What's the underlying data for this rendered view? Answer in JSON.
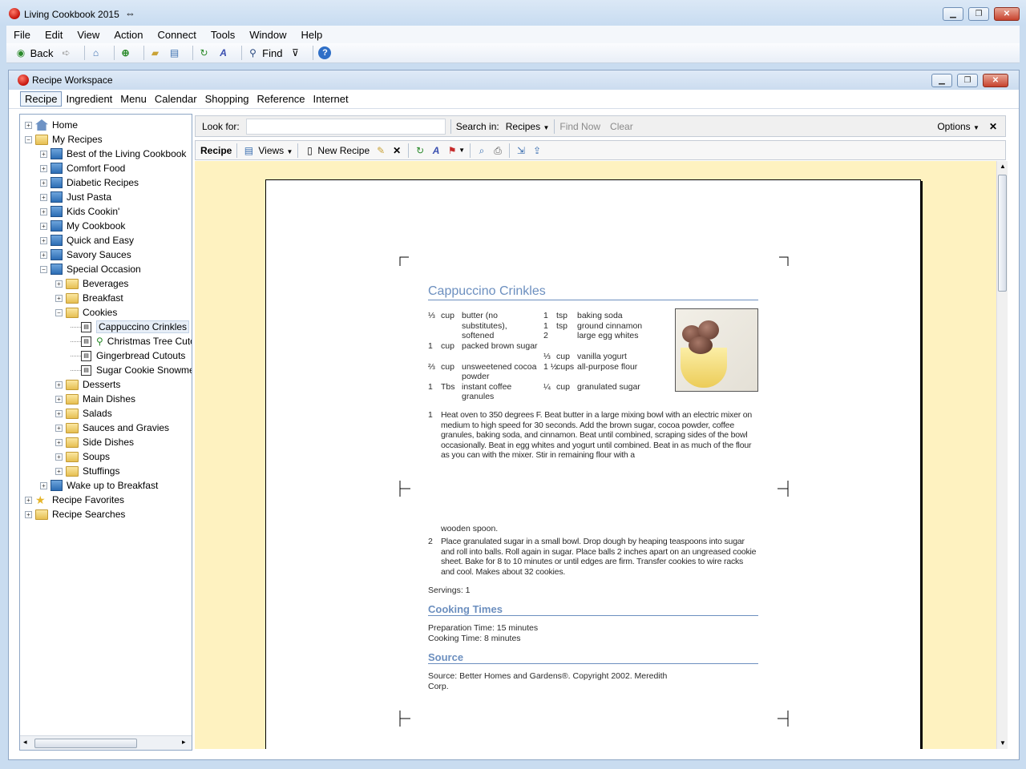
{
  "app": {
    "title": "Living Cookbook 2015"
  },
  "menubar": [
    "File",
    "Edit",
    "View",
    "Action",
    "Connect",
    "Tools",
    "Window",
    "Help"
  ],
  "toolbar": {
    "back": "Back",
    "find": "Find"
  },
  "workspace": {
    "title": "Recipe Workspace",
    "tabs": [
      "Recipe",
      "Ingredient",
      "Menu",
      "Calendar",
      "Shopping",
      "Reference",
      "Internet"
    ]
  },
  "tree": [
    {
      "label": "Home",
      "level": 0,
      "icon": "home"
    },
    {
      "label": "My Recipes",
      "level": 0,
      "icon": "folder"
    },
    {
      "label": "Best of the Living Cookbook",
      "level": 1,
      "icon": "book"
    },
    {
      "label": "Comfort Food",
      "level": 1,
      "icon": "book"
    },
    {
      "label": "Diabetic Recipes",
      "level": 1,
      "icon": "book"
    },
    {
      "label": "Just Pasta",
      "level": 1,
      "icon": "book"
    },
    {
      "label": "Kids Cookin'",
      "level": 1,
      "icon": "book"
    },
    {
      "label": "My Cookbook",
      "level": 1,
      "icon": "book"
    },
    {
      "label": "Quick and Easy",
      "level": 1,
      "icon": "book"
    },
    {
      "label": "Savory Sauces",
      "level": 1,
      "icon": "book"
    },
    {
      "label": "Special Occasion",
      "level": 1,
      "icon": "book"
    },
    {
      "label": "Beverages",
      "level": 2,
      "icon": "folder"
    },
    {
      "label": "Breakfast",
      "level": 2,
      "icon": "folder"
    },
    {
      "label": "Cookies",
      "level": 2,
      "icon": "folder"
    },
    {
      "label": "Cappuccino Crinkles",
      "level": 3,
      "icon": "recipe"
    },
    {
      "label": "Christmas Tree Cutou",
      "level": 3,
      "icon": "recipe"
    },
    {
      "label": "Gingerbread Cutouts",
      "level": 3,
      "icon": "recipe"
    },
    {
      "label": "Sugar Cookie Snowmen",
      "level": 3,
      "icon": "recipe"
    },
    {
      "label": "Desserts",
      "level": 2,
      "icon": "folder"
    },
    {
      "label": "Main Dishes",
      "level": 2,
      "icon": "folder"
    },
    {
      "label": "Salads",
      "level": 2,
      "icon": "folder"
    },
    {
      "label": "Sauces and Gravies",
      "level": 2,
      "icon": "folder"
    },
    {
      "label": "Side Dishes",
      "level": 2,
      "icon": "folder"
    },
    {
      "label": "Soups",
      "level": 2,
      "icon": "folder"
    },
    {
      "label": "Stuffings",
      "level": 2,
      "icon": "folder"
    },
    {
      "label": "Wake up to Breakfast",
      "level": 1,
      "icon": "book"
    },
    {
      "label": "Recipe Favorites",
      "level": 0,
      "icon": "star"
    },
    {
      "label": "Recipe Searches",
      "level": 0,
      "icon": "folder"
    }
  ],
  "search": {
    "look_for": "Look for:",
    "value": "",
    "search_in": "Search in:",
    "scope": "Recipes",
    "find_now": "Find Now",
    "clear": "Clear",
    "options": "Options"
  },
  "recipe_toolbar": {
    "recipe": "Recipe",
    "views": "Views",
    "new_recipe": "New Recipe"
  },
  "recipe": {
    "title": "Cappuccino Crinkles",
    "ingredients_left": [
      {
        "qty": "⅓",
        "unit": "cup",
        "item": "butter (no substitutes), softened"
      },
      {
        "qty": "1",
        "unit": "cup",
        "item": "packed brown sugar"
      },
      {
        "qty": "⅔",
        "unit": "cup",
        "item": "unsweetened cocoa powder"
      },
      {
        "qty": "1",
        "unit": "Tbs",
        "item": "instant coffee granules"
      }
    ],
    "ingredients_right": [
      {
        "qty": "1",
        "unit": "tsp",
        "item": "baking soda"
      },
      {
        "qty": "1",
        "unit": "tsp",
        "item": "ground cinnamon"
      },
      {
        "qty": "2",
        "unit": "",
        "item": "large egg whites"
      },
      {
        "qty": "⅓",
        "unit": "cup",
        "item": "vanilla yogurt"
      },
      {
        "qty": "1 ½",
        "unit": "cups",
        "item": "all-purpose flour"
      },
      {
        "qty": "¼",
        "unit": "cup",
        "item": "granulated sugar"
      }
    ],
    "step1_num": "1",
    "step1": "Heat oven to 350 degrees F. Beat butter in a large mixing bowl with an electric mixer on medium to high speed for 30 seconds. Add the brown sugar, cocoa powder, coffee granules, baking soda, and cinnamon. Beat until combined, scraping sides of the bowl occasionally. Beat in egg whites and yogurt until combined. Beat in as much of the flour as you can with the mixer. Stir in remaining flour with a",
    "step1_cont": "wooden spoon.",
    "step2_num": "2",
    "step2": "Place granulated sugar in a small bowl. Drop dough by heaping teaspoons into sugar and roll into balls. Roll again in sugar. Place balls 2 inches apart on an ungreased cookie sheet. Bake for 8 to 10 minutes or until edges are firm. Transfer cookies to wire racks and cool. Makes about 32 cookies.",
    "servings": "Servings: 1",
    "cooking_times_heading": "Cooking Times",
    "prep_time": "Preparation Time: 15 minutes",
    "cook_time": "Cooking Time: 8 minutes",
    "source_heading": "Source",
    "source": "Source: Better Homes and Gardens®. Copyright 2002. Meredith Corp."
  }
}
